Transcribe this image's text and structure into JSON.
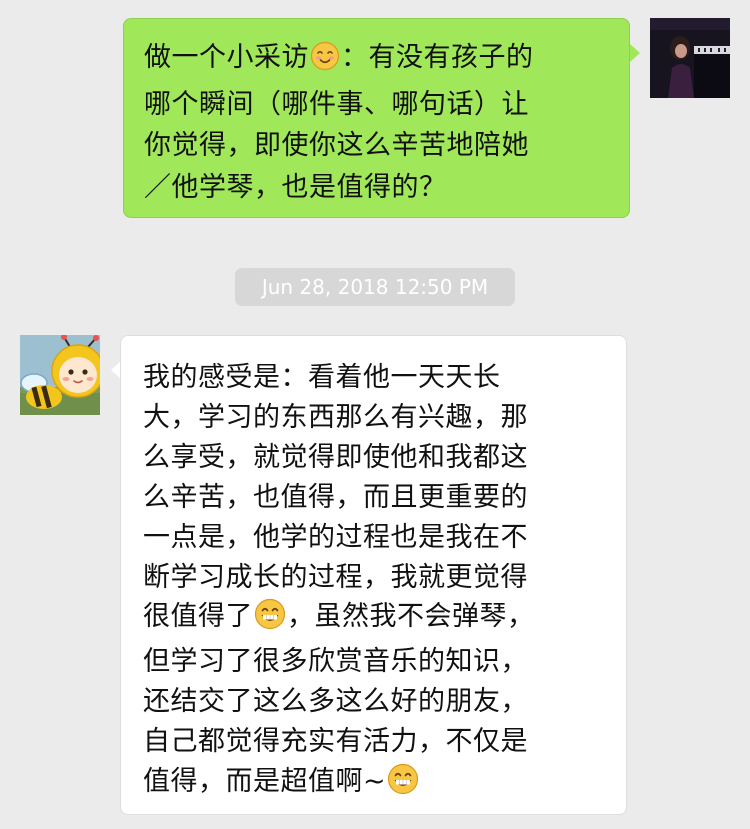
{
  "outgoing": {
    "lines": [
      {
        "a": "做一个小采访",
        "emoji": "smile-emoji",
        "b": "：有没有孩子的"
      },
      {
        "text": "哪个瞬间（哪件事、哪句话）让"
      },
      {
        "text": "你觉得，即使你这么辛苦地陪她"
      },
      {
        "text": "／他学琴，也是值得的？"
      }
    ],
    "bubble_color": "#a0e75a"
  },
  "timestamp": "Jun 28, 2018 12:50 PM",
  "incoming": {
    "lines": [
      {
        "text": "我的感受是：看着他一天天长"
      },
      {
        "text": "大，学习的东西那么有兴趣，那"
      },
      {
        "text": "么享受，就觉得即使他和我都这"
      },
      {
        "text": "么辛苦，也值得，而且更重要的"
      },
      {
        "text": "一点是，他学的过程也是我在不"
      },
      {
        "text": "断学习成长的过程，我就更觉得"
      },
      {
        "a": "很值得了",
        "emoji": "grin-emoji",
        "b": "，虽然我不会弹琴，"
      },
      {
        "text": "但学习了很多欣赏音乐的知识，"
      },
      {
        "text": "还结交了这么多这么好的朋友，"
      },
      {
        "text": "自己都觉得充实有活力，不仅是"
      },
      {
        "a": "值得，而是超值啊~",
        "emoji": "grin-emoji",
        "b": ""
      }
    ],
    "bubble_color": "#ffffff"
  }
}
